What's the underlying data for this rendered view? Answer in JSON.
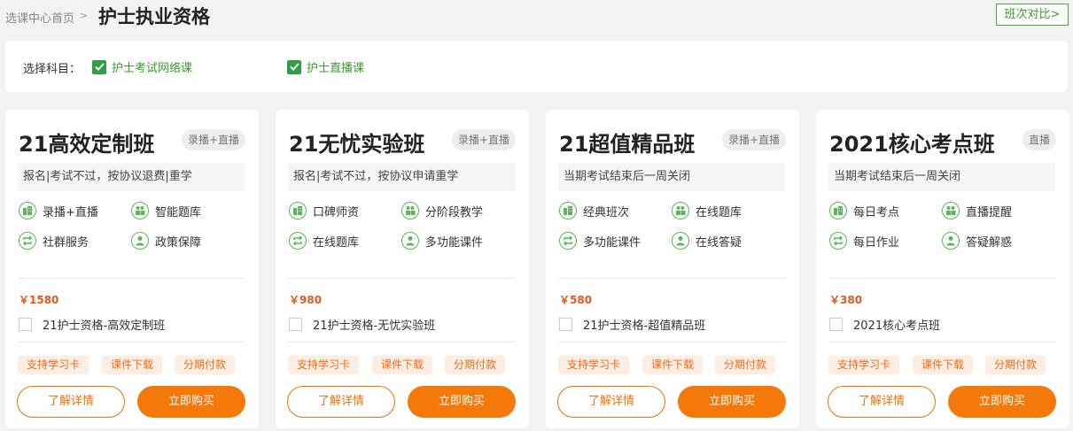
{
  "breadcrumb": {
    "home": "选课中心首页",
    "separator": ">"
  },
  "page_title": "护士执业资格",
  "compare_button": "班次对比>",
  "subject_filter": {
    "label": "选择科目：",
    "options": [
      {
        "label": "护士考试网络课",
        "checked": true
      },
      {
        "label": "护士直播课",
        "checked": true
      }
    ]
  },
  "colors": {
    "accent_green": "#2f9e44",
    "accent_orange": "#f5780a",
    "price_red": "#e8571e"
  },
  "cards": [
    {
      "title": "21高效定制班",
      "mode": "录播+直播",
      "note": "报名|考试不过，按协议退费|重学",
      "features": [
        {
          "label": "录播+直播",
          "icon": "building-icon"
        },
        {
          "label": "智能题库",
          "icon": "group-icon"
        },
        {
          "label": "社群服务",
          "icon": "repeat-icon"
        },
        {
          "label": "政策保障",
          "icon": "person-icon"
        }
      ],
      "price": "￥1580",
      "course_name": "21护士资格-高效定制班",
      "tags": [
        "支持学习卡",
        "课件下载",
        "分期付款"
      ],
      "detail_label": "了解详情",
      "buy_label": "立即购买"
    },
    {
      "title": "21无忧实验班",
      "mode": "录播+直播",
      "note": "报名|考试不过，按协议申请重学",
      "features": [
        {
          "label": "口碑师资",
          "icon": "building-icon"
        },
        {
          "label": "分阶段教学",
          "icon": "group-icon"
        },
        {
          "label": "在线题库",
          "icon": "repeat-icon"
        },
        {
          "label": "多功能课件",
          "icon": "person-icon"
        }
      ],
      "price": "￥980",
      "course_name": "21护士资格-无忧实验班",
      "tags": [
        "支持学习卡",
        "课件下载",
        "分期付款"
      ],
      "detail_label": "了解详情",
      "buy_label": "立即购买"
    },
    {
      "title": "21超值精品班",
      "mode": "录播+直播",
      "note": "当期考试结束后一周关闭",
      "features": [
        {
          "label": "经典班次",
          "icon": "building-icon"
        },
        {
          "label": "在线题库",
          "icon": "group-icon"
        },
        {
          "label": "多功能课件",
          "icon": "repeat-icon"
        },
        {
          "label": "在线答疑",
          "icon": "person-icon"
        }
      ],
      "price": "￥580",
      "course_name": "21护士资格-超值精品班",
      "tags": [
        "支持学习卡",
        "课件下载",
        "分期付款"
      ],
      "detail_label": "了解详情",
      "buy_label": "立即购买"
    },
    {
      "title": "2021核心考点班",
      "mode": "直播",
      "note": "当期考试结束后一周关闭",
      "features": [
        {
          "label": "每日考点",
          "icon": "building-icon"
        },
        {
          "label": "直播提醒",
          "icon": "group-icon"
        },
        {
          "label": "每日作业",
          "icon": "repeat-icon"
        },
        {
          "label": "答疑解惑",
          "icon": "person-icon"
        }
      ],
      "price": "￥380",
      "course_name": "2021核心考点班",
      "tags": [
        "支持学习卡",
        "课件下载",
        "分期付款"
      ],
      "detail_label": "了解详情",
      "buy_label": "立即购买"
    }
  ]
}
